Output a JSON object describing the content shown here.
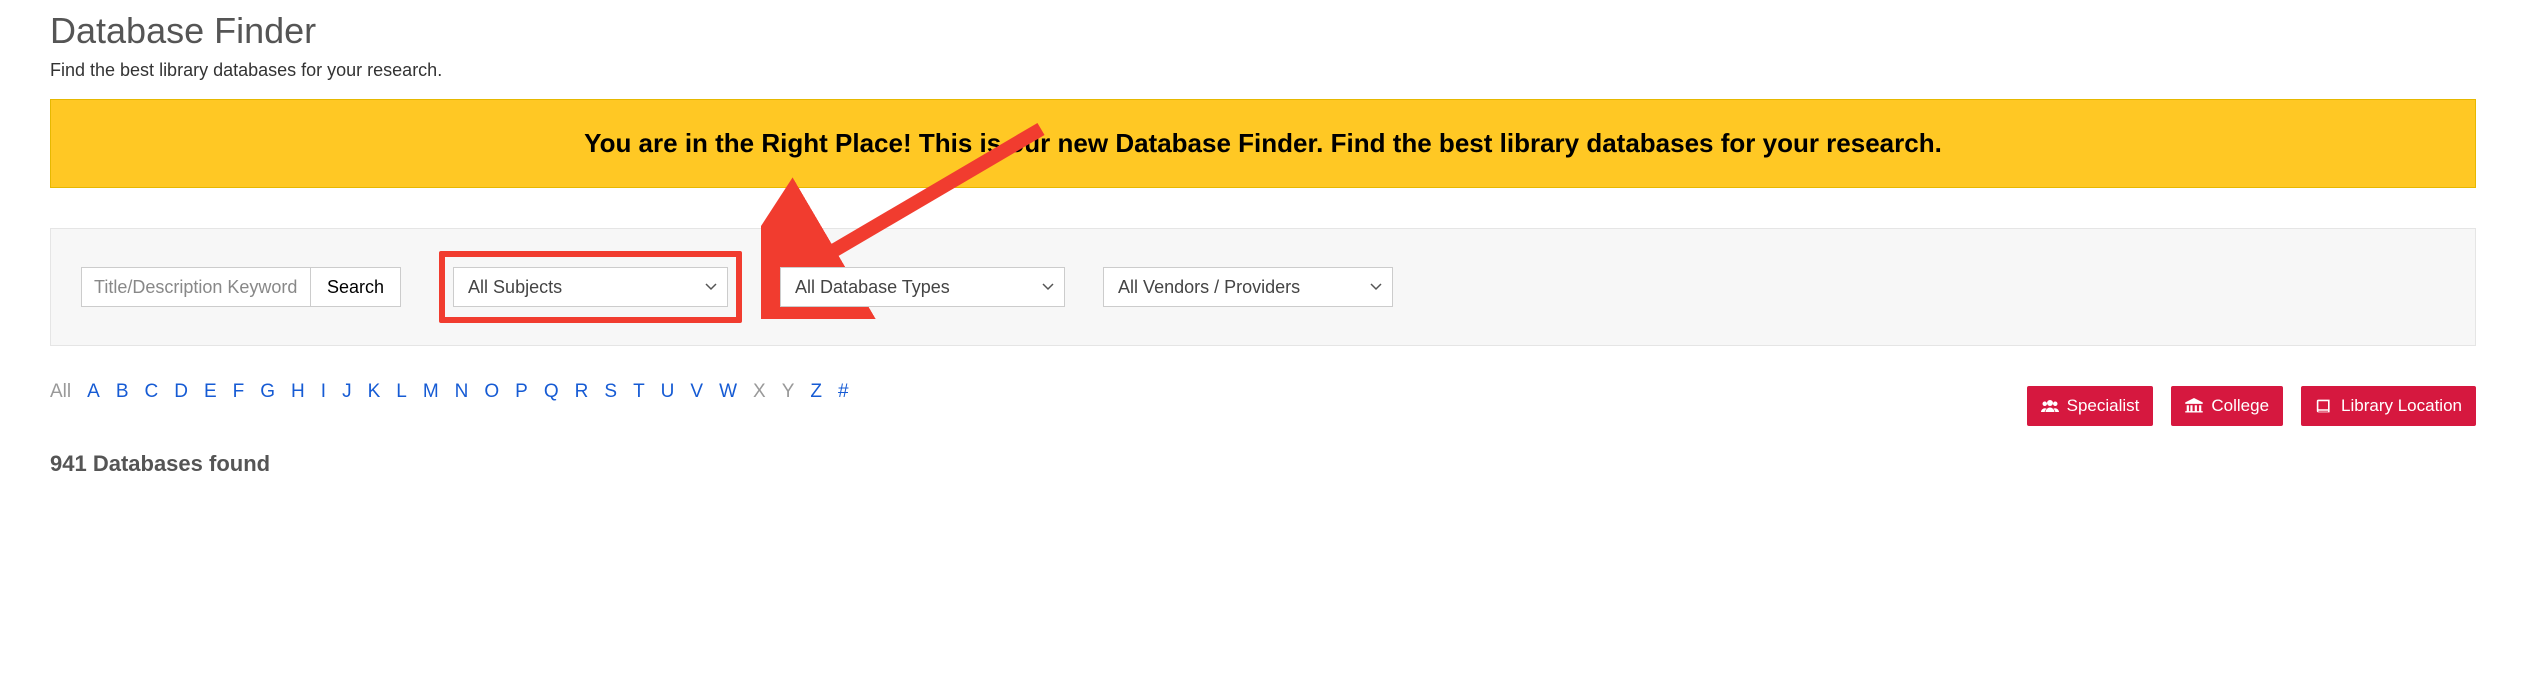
{
  "page": {
    "title": "Database Finder",
    "subtitle": "Find the best library databases for your research."
  },
  "banner": {
    "text": "You are in the Right Place! This is our new Database Finder. Find the best library databases for your research."
  },
  "filters": {
    "search_placeholder": "Title/Description Keyword",
    "search_button": "Search",
    "subject_selected": "All Subjects",
    "type_selected": "All Database Types",
    "vendor_selected": "All Vendors / Providers"
  },
  "alpha": {
    "all": "All",
    "letters": [
      "A",
      "B",
      "C",
      "D",
      "E",
      "F",
      "G",
      "H",
      "I",
      "J",
      "K",
      "L",
      "M",
      "N",
      "O",
      "P",
      "Q",
      "R",
      "S",
      "T",
      "U",
      "V",
      "W",
      "X",
      "Y",
      "Z",
      "#"
    ],
    "disabled": [
      "All",
      "X",
      "Y"
    ]
  },
  "buttons": {
    "specialist": "Specialist",
    "college": "College",
    "library": "Library Location"
  },
  "results": {
    "count_text": "941 Databases found"
  },
  "colors": {
    "banner_bg": "#ffc824",
    "highlight_border": "#f13c2f",
    "link": "#165bd4",
    "red_button": "#d6183f"
  }
}
